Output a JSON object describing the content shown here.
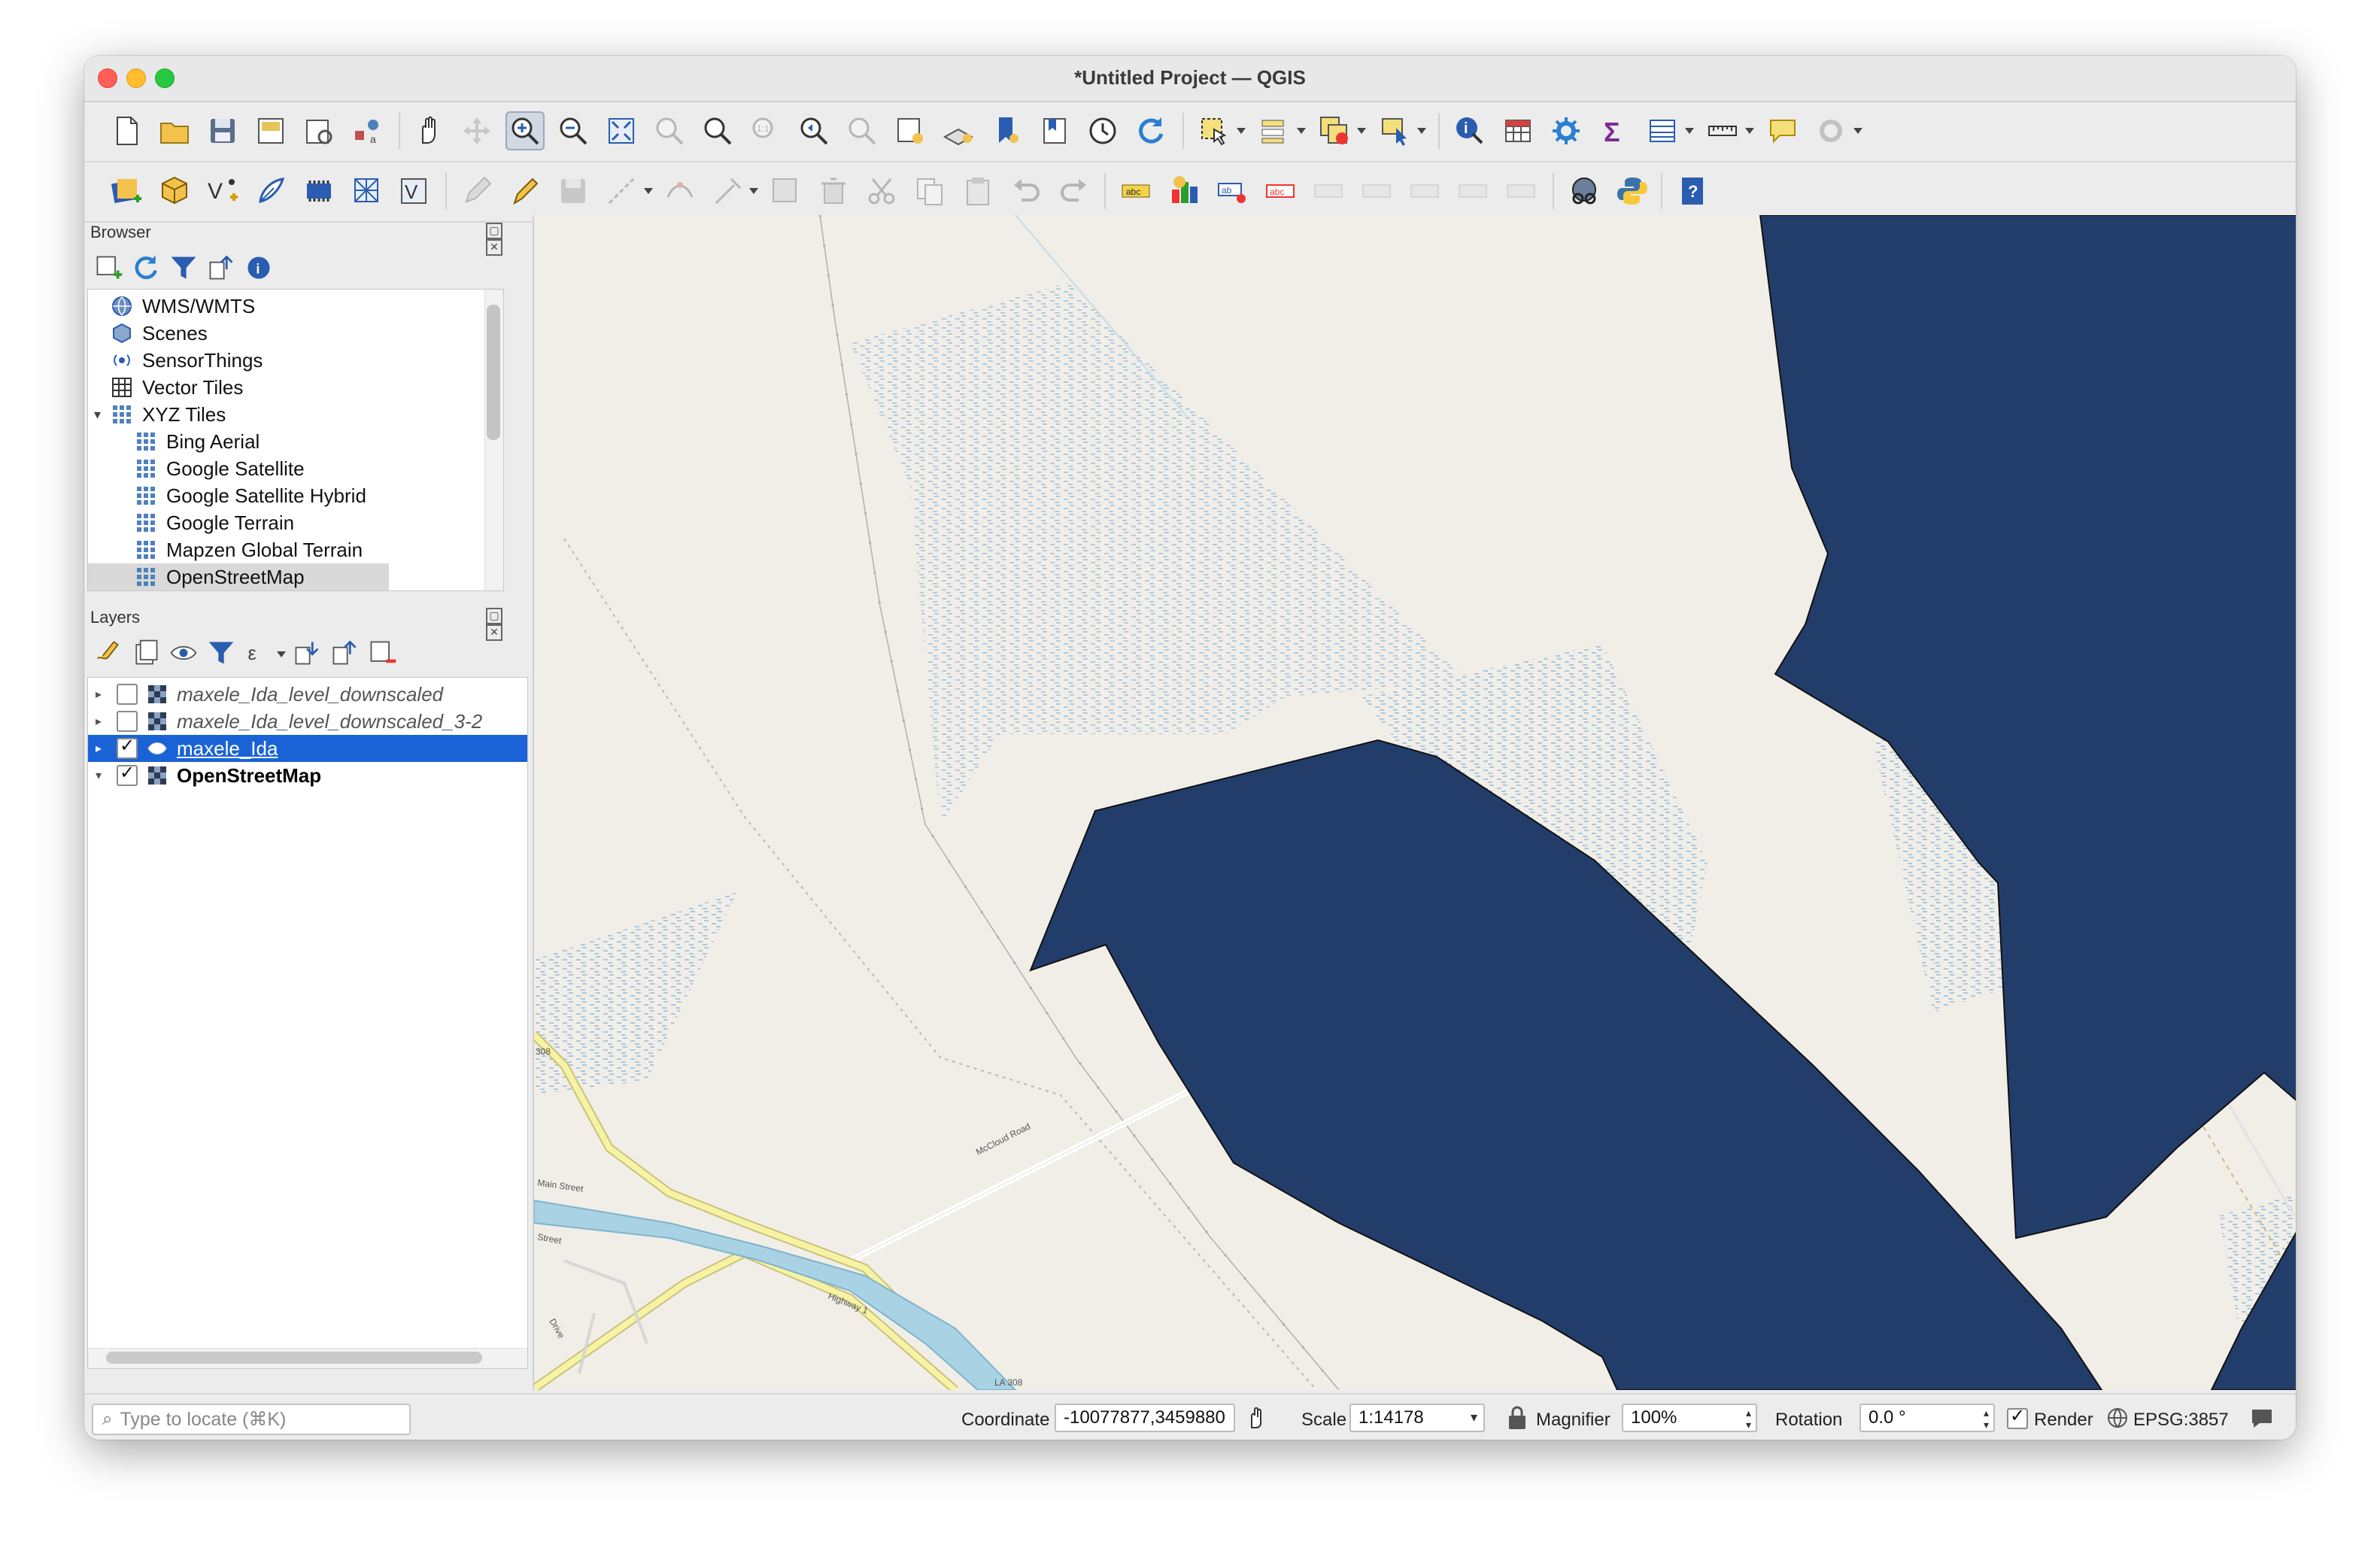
{
  "window": {
    "title": "*Untitled Project — QGIS"
  },
  "browser": {
    "title": "Browser",
    "items": [
      {
        "label": "WMS/WMTS",
        "icon": "globe-icon",
        "indent": 0
      },
      {
        "label": "Scenes",
        "icon": "cube-icon",
        "indent": 0
      },
      {
        "label": "SensorThings",
        "icon": "sensor-icon",
        "indent": 0
      },
      {
        "label": "Vector Tiles",
        "icon": "grid-icon",
        "indent": 0
      },
      {
        "label": "XYZ Tiles",
        "icon": "tiles-icon",
        "indent": 0,
        "expanded": true
      },
      {
        "label": "Bing Aerial",
        "icon": "tiles-icon",
        "indent": 1
      },
      {
        "label": "Google Satellite",
        "icon": "tiles-icon",
        "indent": 1
      },
      {
        "label": "Google Satellite Hybrid",
        "icon": "tiles-icon",
        "indent": 1
      },
      {
        "label": "Google Terrain",
        "icon": "tiles-icon",
        "indent": 1
      },
      {
        "label": "Mapzen Global Terrain",
        "icon": "tiles-icon",
        "indent": 1
      },
      {
        "label": "OpenStreetMap",
        "icon": "tiles-icon",
        "indent": 1,
        "selected": true
      }
    ]
  },
  "layers": {
    "title": "Layers",
    "items": [
      {
        "label": "maxele_Ida_level_downscaled",
        "checked": false,
        "italic": true,
        "selected": false,
        "expand": "▸"
      },
      {
        "label": "maxele_Ida_level_downscaled_3-2",
        "checked": false,
        "italic": true,
        "selected": false,
        "expand": "▸"
      },
      {
        "label": "maxele_Ida",
        "checked": true,
        "italic": false,
        "selected": true,
        "expand": "▸"
      },
      {
        "label": "OpenStreetMap",
        "checked": true,
        "italic": false,
        "selected": false,
        "bold": true,
        "expand": "▾"
      }
    ]
  },
  "map_labels": {
    "mcleod": "McCloud Road",
    "highway": "Highway 1",
    "la308a": "308",
    "la308b": "LA 308",
    "main": "Main Street",
    "street": "Street",
    "drive": "Drive"
  },
  "status": {
    "locate_placeholder": "Type to locate (⌘K)",
    "coordinate_label": "Coordinate",
    "coordinate_value": "-10077877,3459880",
    "scale_label": "Scale",
    "scale_value": "1:14178",
    "magnifier_label": "Magnifier",
    "magnifier_value": "100%",
    "rotation_label": "Rotation",
    "rotation_value": "0.0 °",
    "render_label": "Render",
    "render_checked": true,
    "crs": "EPSG:3857"
  },
  "colors": {
    "flood": "#233d6b",
    "water": "#a9d2e4",
    "land": "#f1eee8",
    "selection": "#1a63d6"
  }
}
